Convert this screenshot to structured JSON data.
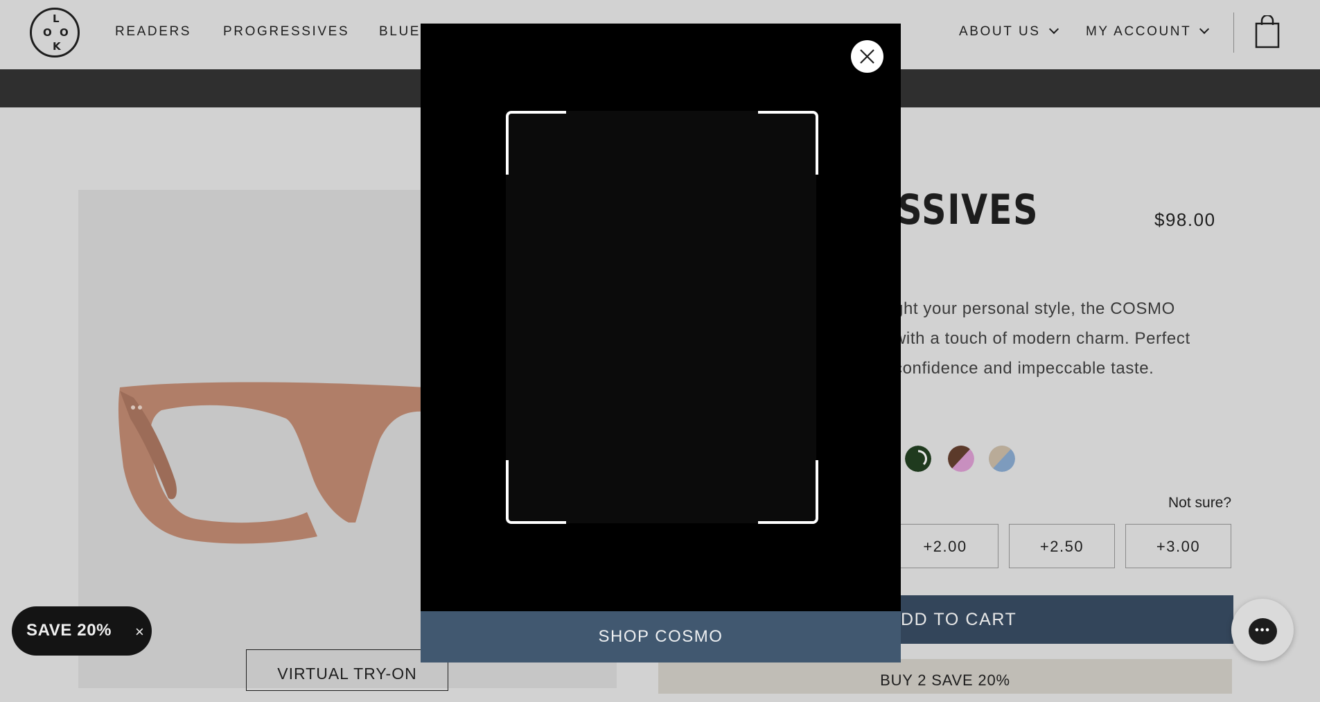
{
  "brand": {
    "logo_letters": [
      "L",
      "O",
      "O",
      "K"
    ]
  },
  "nav": {
    "left": [
      "READERS",
      "PROGRESSIVES",
      "BLUE"
    ],
    "right": [
      {
        "label": "ABOUT US"
      },
      {
        "label": "MY ACCOUNT"
      }
    ],
    "cart_icon": "shopping-bag-icon"
  },
  "product": {
    "title_visible": "ESSIVES",
    "price": "$98.00",
    "description_lines": [
      "ght your personal style, the COSMO",
      "with a touch of modern charm. Perfect",
      " confidence and impeccable taste."
    ],
    "swatches": [
      {
        "name": "dark-green",
        "colors": [
          "#1f3a1e"
        ]
      },
      {
        "name": "brown-pink",
        "colors": [
          "#5b3a2a",
          "#c88fbf"
        ]
      },
      {
        "name": "tan-blue",
        "colors": [
          "#b9ab98",
          "#7d9bbd"
        ]
      }
    ],
    "not_sure": "Not sure?",
    "powers": [
      "+2.00",
      "+2.50",
      "+3.00"
    ],
    "add_to_cart": "DD TO CART",
    "promo": "BUY 2 SAVE 20%",
    "virtual_try_on": "VIRTUAL TRY-ON",
    "frame_color": "#b07e68"
  },
  "save_pill": {
    "label": "SAVE 20%",
    "close": "×"
  },
  "modal": {
    "cta": "SHOP COSMO",
    "close_icon": "close-icon"
  },
  "colors": {
    "accent": "#33455a",
    "modal_cta": "#415870",
    "overlay_bg": "#d2d2d2"
  }
}
